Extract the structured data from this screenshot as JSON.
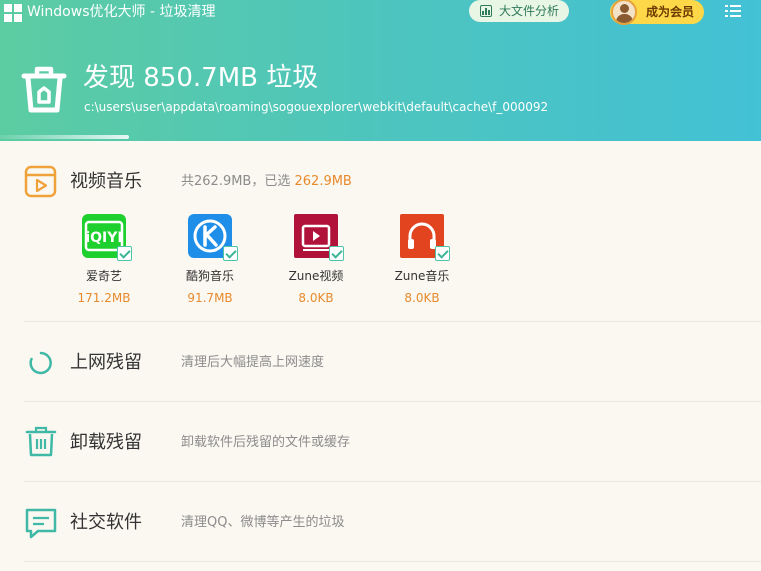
{
  "titlebar": {
    "app_title": "Windows优化大师 - 垃圾清理",
    "big_file_label": "大文件分析",
    "vip_label": "成为会员"
  },
  "summary": {
    "title": "发现 850.7MB 垃圾",
    "path": "c:\\users\\user\\appdata\\roaming\\sogouexplorer\\webkit\\default\\cache\\f_000092",
    "progress": 0.17
  },
  "sections": [
    {
      "title": "视频音乐",
      "desc_prefix": "共262.9MB，已选",
      "desc_highlight": "262.9MB",
      "icon": "play-icon"
    },
    {
      "title": "上网残留",
      "desc": "清理后大幅提高上网速度",
      "icon": "loading-icon"
    },
    {
      "title": "卸载残留",
      "desc": "卸载软件后残留的文件或缓存",
      "icon": "trash-icon"
    },
    {
      "title": "社交软件",
      "desc": "清理QQ、微博等产生的垃圾",
      "icon": "chat-icon"
    }
  ],
  "apps": [
    {
      "name": "爱奇艺",
      "size": "171.2MB",
      "icon": "iqiyi-icon",
      "color": "#1ed02d",
      "checked": true
    },
    {
      "name": "酷狗音乐",
      "size": "91.7MB",
      "icon": "kugou-icon",
      "color": "#1e8ee8",
      "checked": true
    },
    {
      "name": "Zune视频",
      "size": "8.0KB",
      "icon": "zune-video-icon",
      "color": "#b0123a",
      "checked": true
    },
    {
      "name": "Zune音乐",
      "size": "8.0KB",
      "icon": "zune-music-icon",
      "color": "#e1441f",
      "checked": true
    }
  ],
  "colors": {
    "accent": "#4cc4c0",
    "highlight": "#e88a2c",
    "section_icon": "#3fb8a6",
    "music_icon": "#f0a23a"
  }
}
